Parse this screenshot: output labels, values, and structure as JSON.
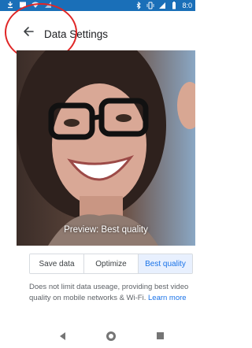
{
  "status_bar": {
    "time": "8:0",
    "color": "#1a6fb8",
    "left_icons": [
      "download-icon",
      "image-icon",
      "wifi-icon",
      "signal-icon"
    ],
    "right_icons": [
      "bluetooth-icon",
      "vibrate-icon",
      "lte-signal-icon",
      "battery-icon"
    ]
  },
  "app_bar": {
    "title": "Data Settings",
    "back_icon": "arrow-left-icon"
  },
  "annotation": {
    "color": "#e02626"
  },
  "preview": {
    "caption": "Preview: Best quality"
  },
  "quality_options": {
    "options": [
      "Save data",
      "Optimize",
      "Best quality"
    ],
    "selected": "Best quality",
    "accent": "#1a73e8"
  },
  "description": {
    "text": "Does not limit data useage, providing best video quality on mobile networks & Wi-Fi.",
    "link": "Learn more"
  },
  "nav_bar": {
    "icons": [
      "nav-back-icon",
      "nav-home-icon",
      "nav-recents-icon"
    ]
  }
}
